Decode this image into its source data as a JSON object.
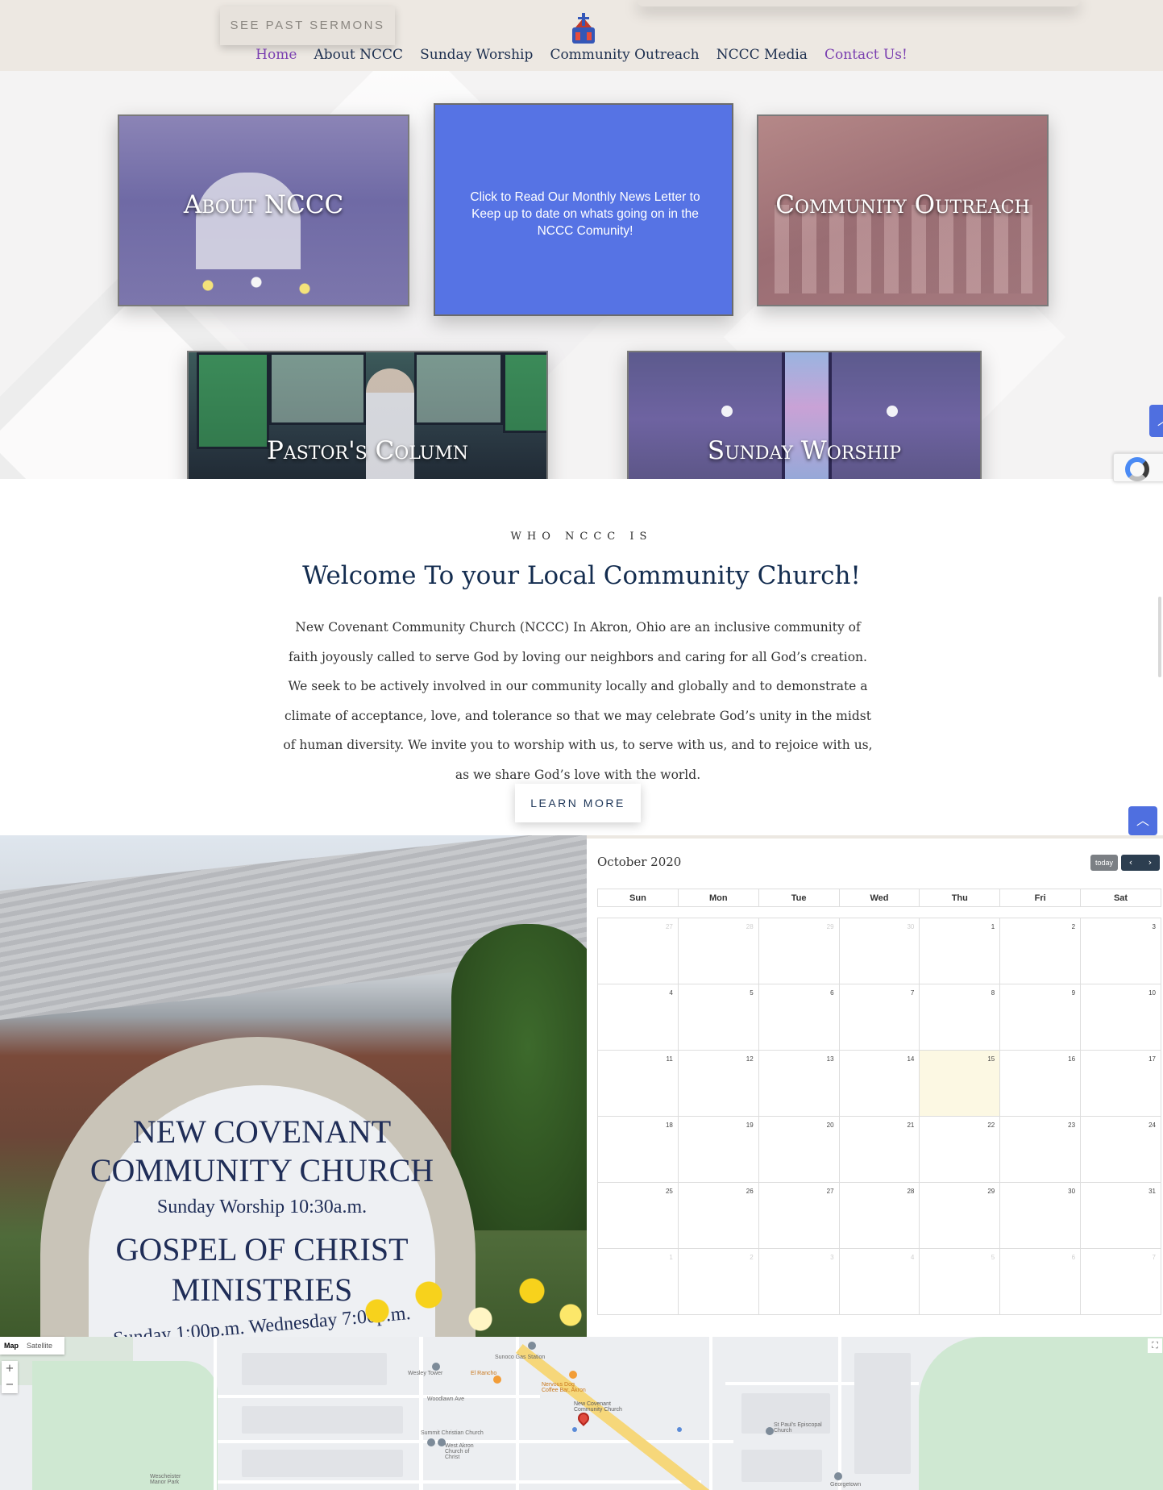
{
  "header": {
    "past_sermons_label": "SEE PAST SERMONS",
    "nav": [
      {
        "label": "Home"
      },
      {
        "label": "About NCCC"
      },
      {
        "label": "Sunday Worship"
      },
      {
        "label": "Community Outreach"
      },
      {
        "label": "NCCC Media"
      },
      {
        "label": "Contact Us!"
      }
    ],
    "accent_color": "#7a3fb0",
    "nav_color": "#1d2f4f"
  },
  "tiles": {
    "about": "About NCCC",
    "news": "Click to Read Our Monthly News Letter to Keep up to date on whats going on in the NCCC Comunity!",
    "outreach": "Community Outreach",
    "pastor": "Pastor's Column",
    "worship": "Sunday Worship",
    "news_color": "#5673e4"
  },
  "welcome": {
    "eyebrow": "WHO NCCC IS",
    "title": "Welcome To your Local Community Church!",
    "body": "New Covenant Community Church (NCCC)  In Akron, Ohio are an inclusive community of faith joyously called to serve God by loving our neighbors and caring for all God’s creation. We seek to be actively involved in our community locally and globally and to demonstrate a climate of acceptance, love, and tolerance so that we may celebrate God’s unity in the midst of human diversity. We invite you to worship with us, to serve with us, and to rejoice with us, as we share God’s love with the world.",
    "learn_more": "LEARN MORE"
  },
  "photo_sign": {
    "line1": "NEW COVENANT",
    "line2": "COMMUNITY CHURCH",
    "line3": "Sunday Worship 10:30a.m.",
    "line4": "GOSPEL OF CHRIST",
    "line5": "MINISTRIES",
    "line6": "Sunday 1:00p.m. Wednesday 7:00p.m."
  },
  "calendar": {
    "title": "October 2020",
    "today_label": "today",
    "prev_icon": "‹",
    "next_icon": "›",
    "weekdays": [
      "Sun",
      "Mon",
      "Tue",
      "Wed",
      "Thu",
      "Fri",
      "Sat"
    ],
    "weeks": [
      [
        "27",
        "28",
        "29",
        "30",
        "1",
        "2",
        "3"
      ],
      [
        "4",
        "5",
        "6",
        "7",
        "8",
        "9",
        "10"
      ],
      [
        "11",
        "12",
        "13",
        "14",
        "15",
        "16",
        "17"
      ],
      [
        "18",
        "19",
        "20",
        "21",
        "22",
        "23",
        "24"
      ],
      [
        "25",
        "26",
        "27",
        "28",
        "29",
        "30",
        "31"
      ],
      [
        "1",
        "2",
        "3",
        "4",
        "5",
        "6",
        "7"
      ]
    ],
    "today_date": "15",
    "today_bg": "#fcf8e3"
  },
  "map": {
    "type_map": "Map",
    "type_satellite": "Satellite",
    "zoom_in": "+",
    "zoom_out": "−",
    "labels": {
      "gas": "Sunoco Gas Station",
      "tower": "Wesley Tower",
      "rancho": "El Rancho",
      "coffee": "Nervous Dog Coffee Bar, Akron",
      "church": "New Covenant Community Church",
      "summit": "Summit Christian Church",
      "westakron": "West Akron Church of Christ",
      "stpauls": "St Paul's Episcopal Church",
      "woodlawn": "Woodlawn Ave",
      "georgetown": "Georgetown",
      "mayfair": "Wescheister Manor Park"
    }
  }
}
